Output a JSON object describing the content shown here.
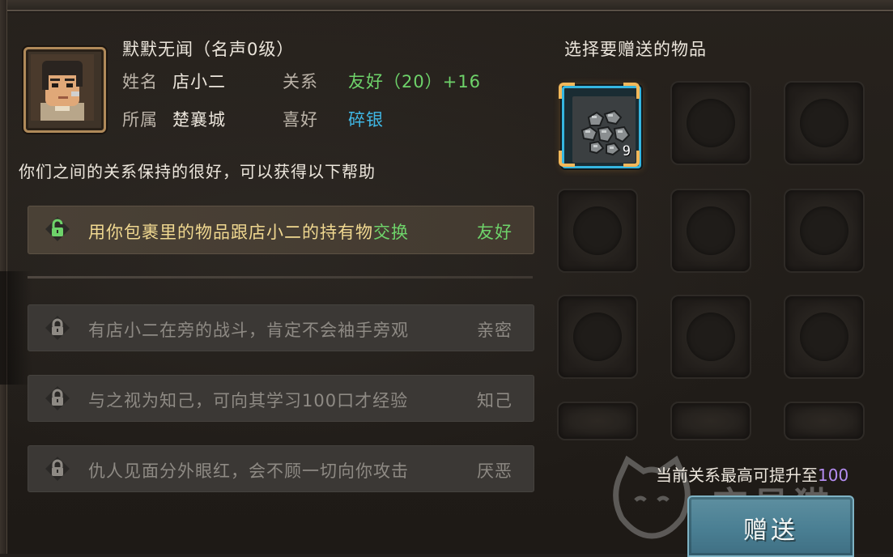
{
  "npc": {
    "header": "默默无闻（名声0级）",
    "name_label": "姓名",
    "name_value": "店小二",
    "faction_label": "所属",
    "faction_value": "楚襄城",
    "relation_label": "关系",
    "relation_value": "友好（20）+16",
    "likes_label": "喜好",
    "likes_value": "碎银"
  },
  "relation_summary": "你们之间的关系保持的很好，可以获得以下帮助",
  "help_items": [
    {
      "prefix": "用你包裹里的物品跟店小二的持有物",
      "highlight": "交换",
      "tag": "友好",
      "unlocked": true
    },
    {
      "text": "有店小二在旁的战斗，肯定不会袖手旁观",
      "tag": "亲密",
      "unlocked": false
    },
    {
      "text": "与之视为知己，可向其学习100口才经验",
      "tag": "知己",
      "unlocked": false
    },
    {
      "text": "仇人见面分外眼红，会不顾一切向你攻击",
      "tag": "厌恶",
      "unlocked": false
    }
  ],
  "gift_panel": {
    "title": "选择要赠送的物品",
    "selected_item": {
      "name": "碎银",
      "count": "9"
    },
    "max_relation_prefix": "当前关系最高可提升至",
    "max_relation_value": "100",
    "gift_button_label": "赠送"
  },
  "watermark": "交易猫",
  "colors": {
    "green": "#6ed36a",
    "blue": "#3fb8e6",
    "purple": "#b48cf0",
    "gold": "#f0d890"
  }
}
